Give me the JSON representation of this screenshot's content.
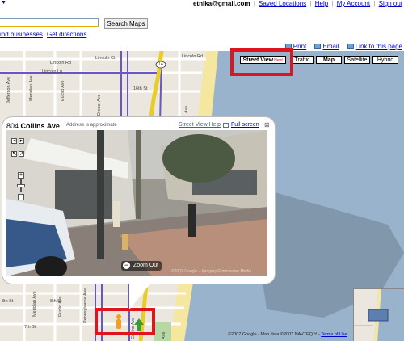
{
  "header": {
    "corner_arrow": "▼",
    "email": "etnika@gmail.com",
    "links": [
      "Saved Locations",
      "Help",
      "My Account",
      "Sign out"
    ]
  },
  "search": {
    "value": "",
    "button_label": "Search Maps",
    "link_businesses": "ind businesses",
    "link_directions": "Get directions"
  },
  "map_tools": {
    "print": "Print",
    "email": "Email",
    "link": "Link to this page"
  },
  "map_types": {
    "street_view": "Street View",
    "street_view_badge": "New!",
    "traffic": "Traffic",
    "map": "Map",
    "satellite": "Satellite",
    "hybrid": "Hybrid",
    "selected": "Map"
  },
  "popup": {
    "address_number": "804",
    "address_street": "Collins Ave",
    "approx": "Address is approximate",
    "help": "Street View Help",
    "fullscreen": "Full-screen",
    "close": "⊠",
    "zoom_out": "Zoom Out",
    "image_credit": "©2007 Google – Imagery ©Immersive Media"
  },
  "streets": {
    "lincoln_ct": "Lincoln Ct",
    "lincoln_rd_left": "Lincoln Rd",
    "lincoln_rd_mid": "Lincoln Rd",
    "lincoln_ln": "Lincoln Ln",
    "st_16th": "16th St",
    "meridian": "Meridian Ave",
    "euclid_top": "Euclid Ave",
    "jefferson": "Jefferson Ave",
    "drexel": "Drexel Ave",
    "ave_top": "Ave",
    "route": "1A",
    "st_8th_left": "8th St",
    "st_8th_mid": "8th St",
    "st_7th": "7th St",
    "euclid_bottom": "Euclid Ave",
    "meridian_bottom": "Meridian Ave",
    "pennsylvania": "Pennsylvania Ave",
    "collins": "Collins Ave",
    "ave_bottom": "Ave"
  },
  "copyright": {
    "text": "©2007 Google - Map data ©2007 NAVTEQ™ -",
    "terms": "Terms of Use"
  },
  "colors": {
    "highlight": "#e0141e",
    "water": "#99b3cc",
    "beach": "#f5e6a0",
    "land": "#ece7de",
    "link": "#0000cc"
  }
}
